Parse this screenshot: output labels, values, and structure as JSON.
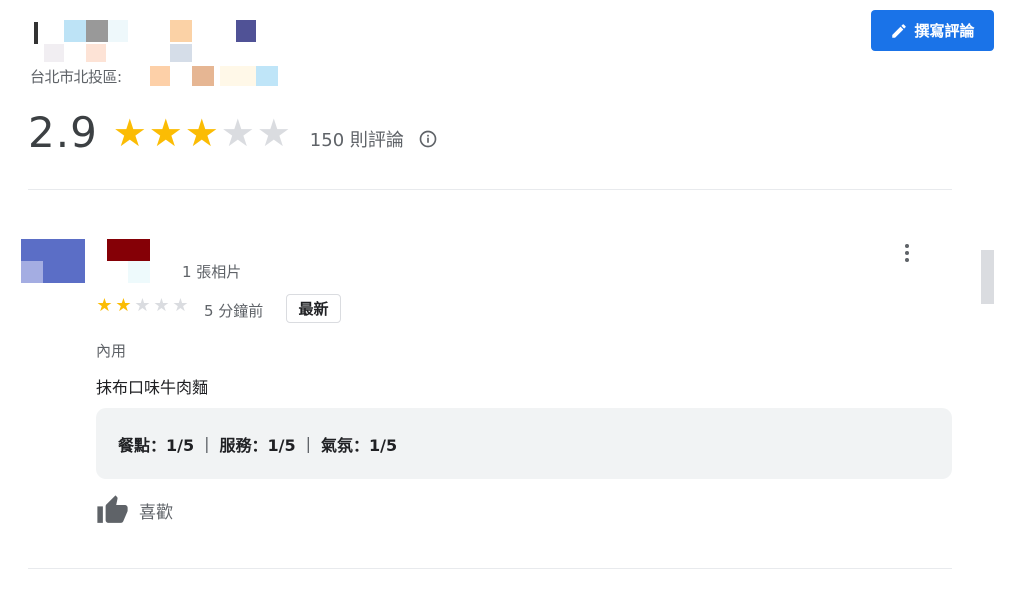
{
  "header": {
    "address": "台北市北投區",
    "write_review_label": "撰寫評論"
  },
  "summary": {
    "rating": "2.9",
    "stars_filled": 3,
    "stars_total": 5,
    "review_count": "150 則評論"
  },
  "review": {
    "photo_count": "1 張相片",
    "stars_filled": 2,
    "stars_total": 5,
    "time": "5 分鐘前",
    "badge": "最新",
    "service_type": "內用",
    "text": "抹布口味牛肉麵",
    "sub_ratings": {
      "food": "餐點：1/5",
      "service": "服務：1/5",
      "atmosphere": "氣氛：1/5",
      "separator": "|"
    },
    "like_label": "喜歡"
  },
  "icons": [
    "pen-icon",
    "info-icon",
    "more-vert-icon",
    "thumb-up-icon"
  ],
  "colors": {
    "accent": "#1a73e8",
    "star": "#fbbc04",
    "star_empty": "#dadce0"
  }
}
